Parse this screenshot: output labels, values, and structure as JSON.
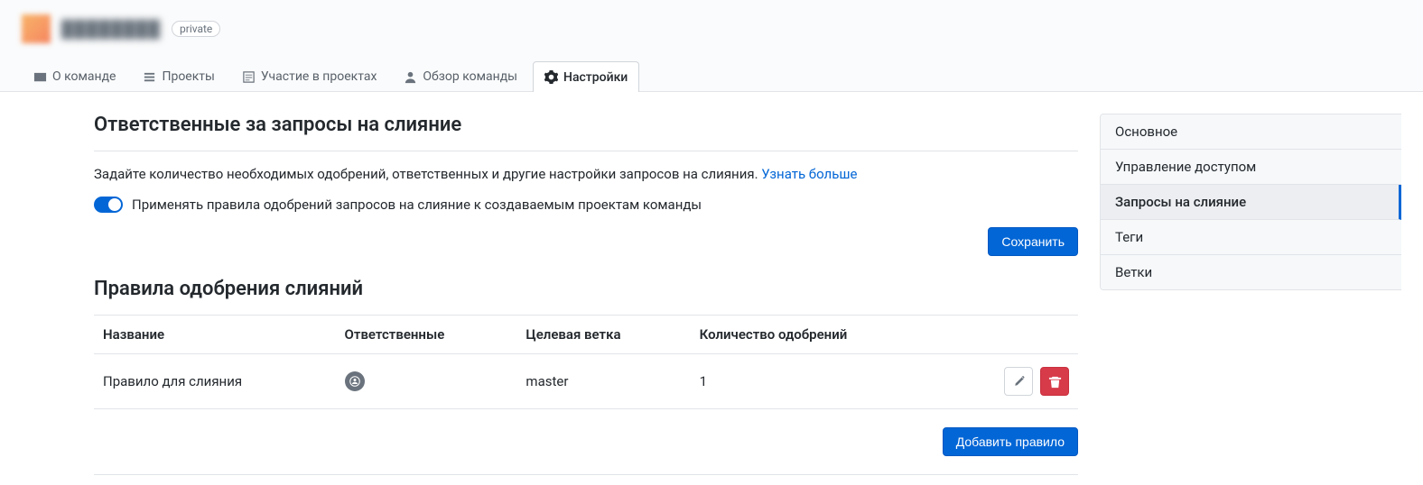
{
  "header": {
    "team_name": "████████",
    "visibility_badge": "private"
  },
  "tabs": [
    {
      "label": "О команде"
    },
    {
      "label": "Проекты"
    },
    {
      "label": "Участие в проектах"
    },
    {
      "label": "Обзор команды"
    },
    {
      "label": "Настройки"
    }
  ],
  "sidebar": {
    "items": [
      {
        "label": "Основное"
      },
      {
        "label": "Управление доступом"
      },
      {
        "label": "Запросы на слияние",
        "active": true
      },
      {
        "label": "Теги"
      },
      {
        "label": "Ветки"
      }
    ]
  },
  "merge": {
    "title": "Ответственные за запросы на слияние",
    "description": "Задайте количество необходимых одобрений, ответственных и другие настройки запросов на слияния.",
    "learn_more": "Узнать больше",
    "toggle_label": "Применять правила одобрений запросов на слияние к создаваемым проектам команды",
    "toggle_on": true,
    "save_label": "Сохранить"
  },
  "rules": {
    "title": "Правила одобрения слияний",
    "columns": {
      "name": "Название",
      "responsibles": "Ответственные",
      "branch": "Целевая ветка",
      "approvals": "Количество одобрений"
    },
    "rows": [
      {
        "name": "Правило для слияния",
        "branch": "master",
        "approvals": "1"
      }
    ],
    "add_label": "Добавить правило"
  }
}
